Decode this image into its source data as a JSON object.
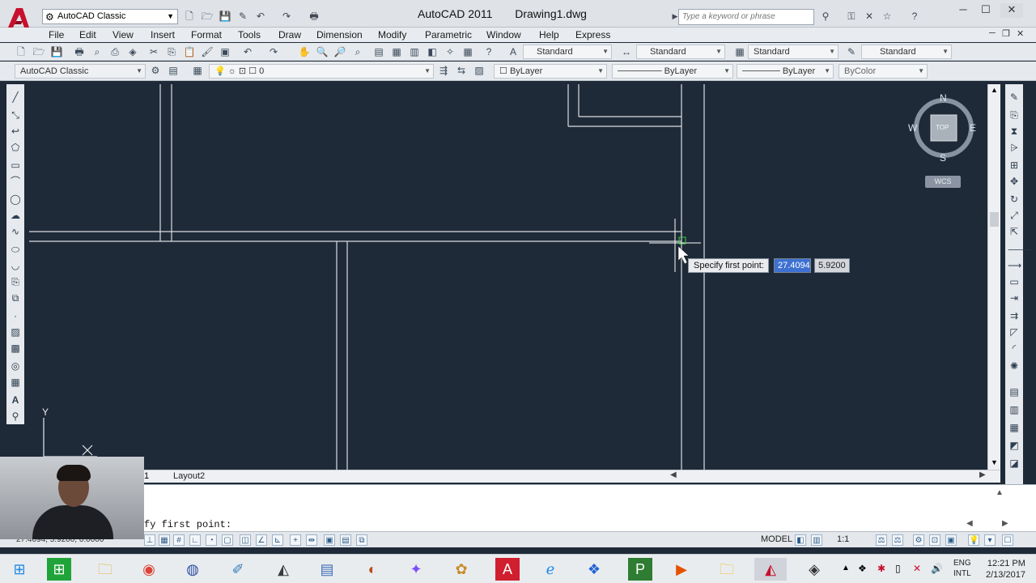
{
  "app": {
    "name": "AutoCAD 2011",
    "document": "Drawing1.dwg",
    "workspace": "AutoCAD Classic"
  },
  "search": {
    "placeholder": "Type a keyword or phrase"
  },
  "menu": [
    "File",
    "Edit",
    "View",
    "Insert",
    "Format",
    "Tools",
    "Draw",
    "Dimension",
    "Modify",
    "Parametric",
    "Window",
    "Help",
    "Express"
  ],
  "styles_toolbar": {
    "text_style": "Standard",
    "dim_style": "Standard",
    "table_style": "Standard",
    "multileader_style": "Standard"
  },
  "layers_toolbar": {
    "workspace": "AutoCAD Classic",
    "layer": "0",
    "color": "ByLayer",
    "linetype": "ByLayer",
    "lineweight": "ByLayer",
    "plot_style": "ByColor"
  },
  "viewcube": {
    "north": "N",
    "south": "S",
    "east": "E",
    "west": "W",
    "face": "TOP",
    "ucs": "WCS"
  },
  "ucs_icon": {
    "y": "Y"
  },
  "dynamic_input": {
    "prompt": "Specify first point:",
    "x": "27.4094",
    "y": "5.9200"
  },
  "layout_tabs": {
    "partial": "1",
    "layout2": "Layout2"
  },
  "command_line": {
    "prompt": "fy first point:"
  },
  "status": {
    "coordinates": "27.4094, 5.9200, 0.0000",
    "model": "MODEL",
    "scale": "1:1"
  },
  "taskbar": {
    "language_1": "ENG",
    "language_2": "INTL",
    "time": "12:21 PM",
    "date": "2/13/2017"
  },
  "colors": {
    "canvas": "#1f2a38",
    "accent": "#3d70d1",
    "logo_red": "#c8102e"
  }
}
